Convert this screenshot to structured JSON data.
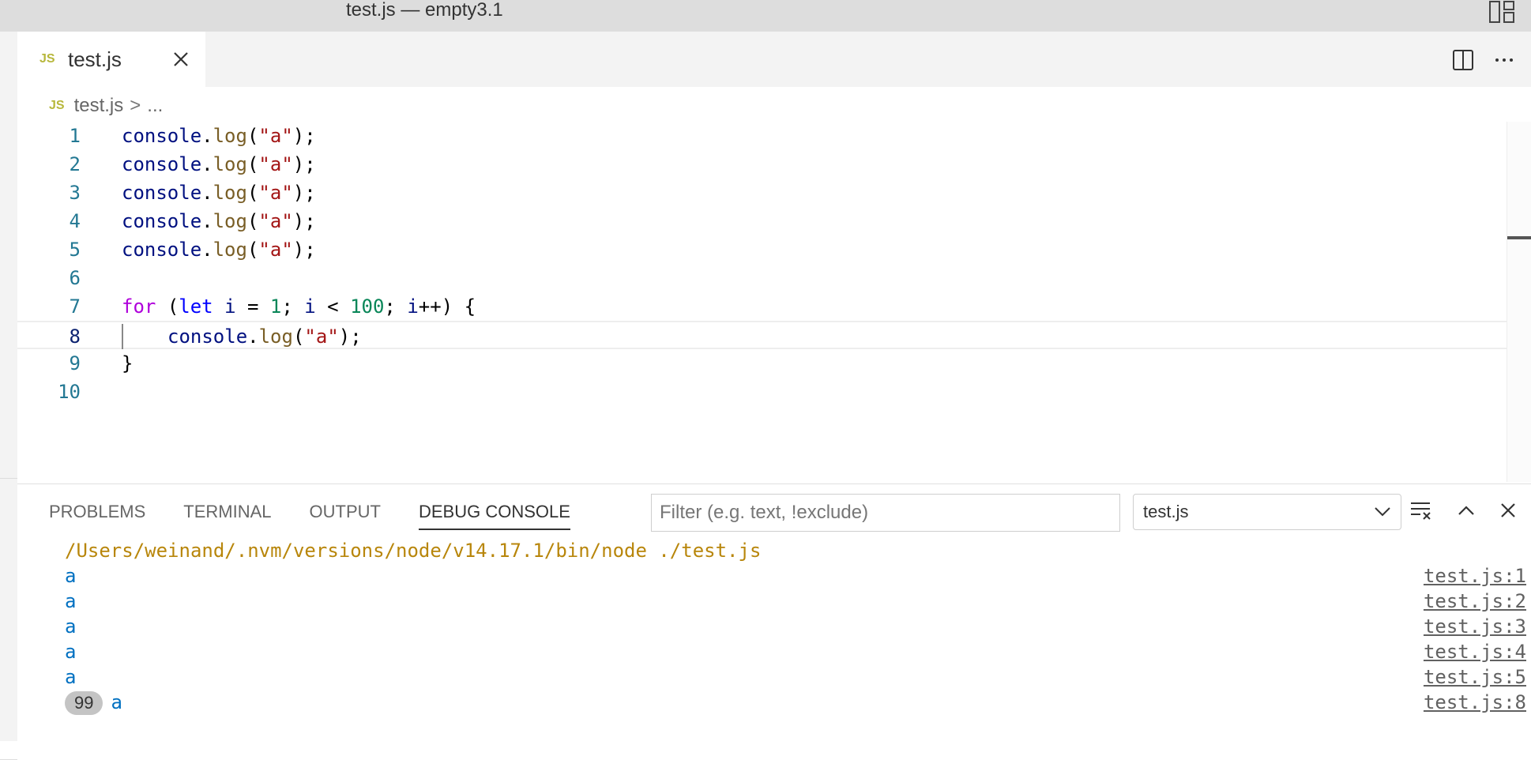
{
  "window": {
    "title": "test.js — empty3.1"
  },
  "tab": {
    "badge": "JS",
    "label": "test.js"
  },
  "breadcrumb": {
    "badge": "JS",
    "file": "test.js",
    "separator": ">",
    "more": "..."
  },
  "editor": {
    "line_numbers": [
      "1",
      "2",
      "3",
      "4",
      "5",
      "6",
      "7",
      "8",
      "9",
      "10"
    ],
    "current_line": 8,
    "code": {
      "console": "console",
      "dot": ".",
      "log": "log",
      "open": "(",
      "str": "\"a\"",
      "close": ");",
      "for": "for",
      "paren_open": "(",
      "let": "let",
      "i": "i",
      "eq": "=",
      "one": "1",
      "semi": ";",
      "lt": "<",
      "hundred": "100",
      "inc": "++",
      "brace_open": ") {",
      "brace_close": "}"
    }
  },
  "panel": {
    "tabs": [
      "PROBLEMS",
      "TERMINAL",
      "OUTPUT",
      "DEBUG CONSOLE"
    ],
    "active_tab": "DEBUG CONSOLE",
    "filter_placeholder": "Filter (e.g. text, !exclude)",
    "filter_value": "",
    "session_select": "test.js"
  },
  "console": {
    "command": "/Users/weinand/.nvm/versions/node/v14.17.1/bin/node ./test.js",
    "lines": [
      {
        "msg": "a",
        "src": "test.js:1"
      },
      {
        "msg": "a",
        "src": "test.js:2"
      },
      {
        "msg": "a",
        "src": "test.js:3"
      },
      {
        "msg": "a",
        "src": "test.js:4"
      },
      {
        "msg": "a",
        "src": "test.js:5"
      }
    ],
    "repeat": {
      "count": "99",
      "msg": "a",
      "src": "test.js:8"
    }
  },
  "colors": {
    "accent_js": "#b7b73b",
    "console_msg": "#0070c1",
    "command": "#b8860b"
  }
}
